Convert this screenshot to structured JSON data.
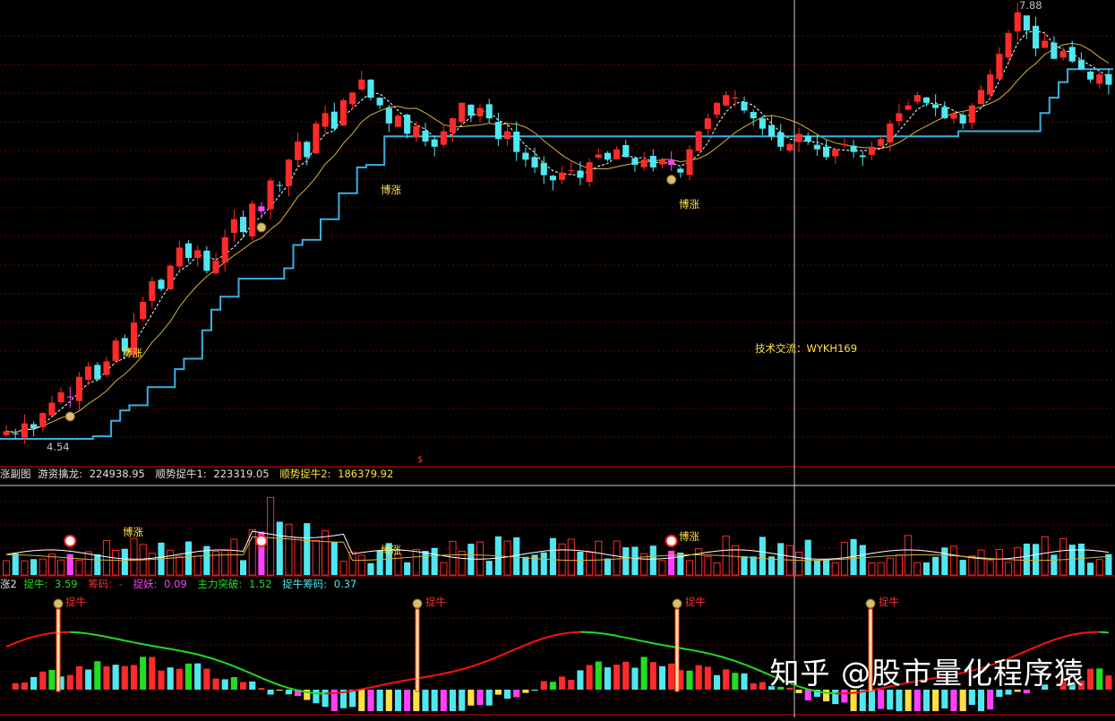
{
  "colors": {
    "up": "#ff2a2a",
    "down": "#4fe8f0",
    "ma_fast": "#ffffff",
    "ma_slow": "#d8b23a",
    "support": "#3ab0e0",
    "grid": "#6a0000",
    "divider": "#b00000",
    "signal": "#ff40ff",
    "label_yellow": "#ffe040",
    "green_line": "#22dd22",
    "red_line": "#ff1010"
  },
  "main_panel": {
    "high_label": "7.88",
    "low_label": "4.54",
    "contact_label": "技术交流：WYKH169",
    "signal_label": "博涨",
    "marker": "$"
  },
  "volume_panel": {
    "title_prefix": "涨副图",
    "items": [
      {
        "label": "游资擒龙:",
        "value": "224938.95",
        "color": "#e0e0e0"
      },
      {
        "label": "顺势捉牛1:",
        "value": "223319.05",
        "color": "#e0e0e0"
      },
      {
        "label": "顺势捉牛2:",
        "value": "186379.92",
        "color": "#ffe040"
      }
    ],
    "signal_label": "博涨"
  },
  "indicator_panel": {
    "title_prefix": "涨2",
    "items": [
      {
        "label": "捉牛:",
        "value": "3.59",
        "color": "#22dd22"
      },
      {
        "label": "筹码:",
        "value": "-",
        "color": "#ff3030"
      },
      {
        "label": "捉妖:",
        "value": "0.09",
        "color": "#ff40ff"
      },
      {
        "label": "主力突破:",
        "value": "1.52",
        "color": "#22dd22"
      },
      {
        "label": "捉牛筹码:",
        "value": "0.37",
        "color": "#4fe8f0"
      }
    ],
    "signal_label": "捉牛"
  },
  "watermark": "知乎 @股市量化程序猿",
  "chart_data": {
    "type": "candlestick",
    "high": 7.88,
    "low": 4.54,
    "series": [
      {
        "name": "游资擒龙",
        "last": 224938.95
      },
      {
        "name": "顺势捉牛1",
        "last": 223319.05
      },
      {
        "name": "顺势捉牛2",
        "last": 186379.92
      }
    ],
    "indicators": {
      "捉牛": 3.59,
      "筹码": "-",
      "捉妖": 0.09,
      "主力突破": 1.52,
      "捉牛筹码": 0.37
    },
    "close_path": [
      4.6,
      4.58,
      4.66,
      4.62,
      4.74,
      4.82,
      4.9,
      4.86,
      5.02,
      5.1,
      5.0,
      5.14,
      5.3,
      5.22,
      5.44,
      5.6,
      5.76,
      5.7,
      5.88,
      6.02,
      5.94,
      6.0,
      5.84,
      5.92,
      6.1,
      6.24,
      6.14,
      6.36,
      6.3,
      6.54,
      6.5,
      6.7,
      6.84,
      6.72,
      6.98,
      7.06,
      6.94,
      7.16,
      7.22,
      7.32,
      7.18,
      7.12,
      6.98,
      7.04,
      6.9,
      6.96,
      6.84,
      6.8,
      6.92,
      7.02,
      7.14,
      7.04,
      7.1,
      7.02,
      6.86,
      6.92,
      6.76,
      6.7,
      6.64,
      6.58,
      6.54,
      6.6,
      6.62,
      6.56,
      6.68,
      6.74,
      6.7,
      6.78,
      6.72,
      6.66,
      6.7,
      6.64,
      6.7,
      6.66,
      6.6,
      6.78,
      6.92,
      7.02,
      7.14,
      7.2,
      7.18,
      7.08,
      7.02,
      6.94,
      6.88,
      6.8,
      6.82,
      6.9,
      6.84,
      6.78,
      6.72,
      6.78,
      6.82,
      6.76,
      6.72,
      6.8,
      6.86,
      6.98,
      7.06,
      7.12,
      7.2,
      7.14,
      7.1,
      7.02,
      7.06,
      6.98,
      7.12,
      7.24,
      7.36,
      7.52,
      7.68,
      7.84,
      7.7,
      7.56,
      7.62,
      7.48,
      7.54,
      7.46,
      7.4,
      7.32,
      7.36,
      7.28
    ],
    "signals_at": [
      7,
      28,
      73
    ]
  }
}
